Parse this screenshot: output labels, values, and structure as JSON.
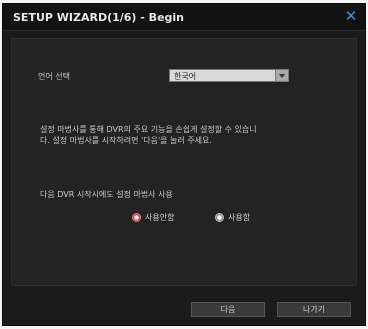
{
  "dialog": {
    "title": "SETUP WIZARD(1/6) - Begin",
    "close_icon": "close-x-icon"
  },
  "language": {
    "label": "언어 선택",
    "selected": "한국어"
  },
  "description": {
    "line1": "설정 마법사를 통해 DVR의 주요 기능을 손쉽게 설정할 수 있습니",
    "line2": "다. 설정 마법사를 시작하려면 '다음'을 눌러 주세요."
  },
  "startup": {
    "label": "다음 DVR 시작시에도 설정 마법사 사용",
    "options": [
      {
        "label": "사용안함",
        "selected": true
      },
      {
        "label": "사용함",
        "selected": false
      }
    ]
  },
  "buttons": {
    "next": "다음",
    "exit": "나가기"
  },
  "colors": {
    "background": "#1b1b1b",
    "accent": "#3d8fe0",
    "radio_on": "#d23a3a"
  }
}
